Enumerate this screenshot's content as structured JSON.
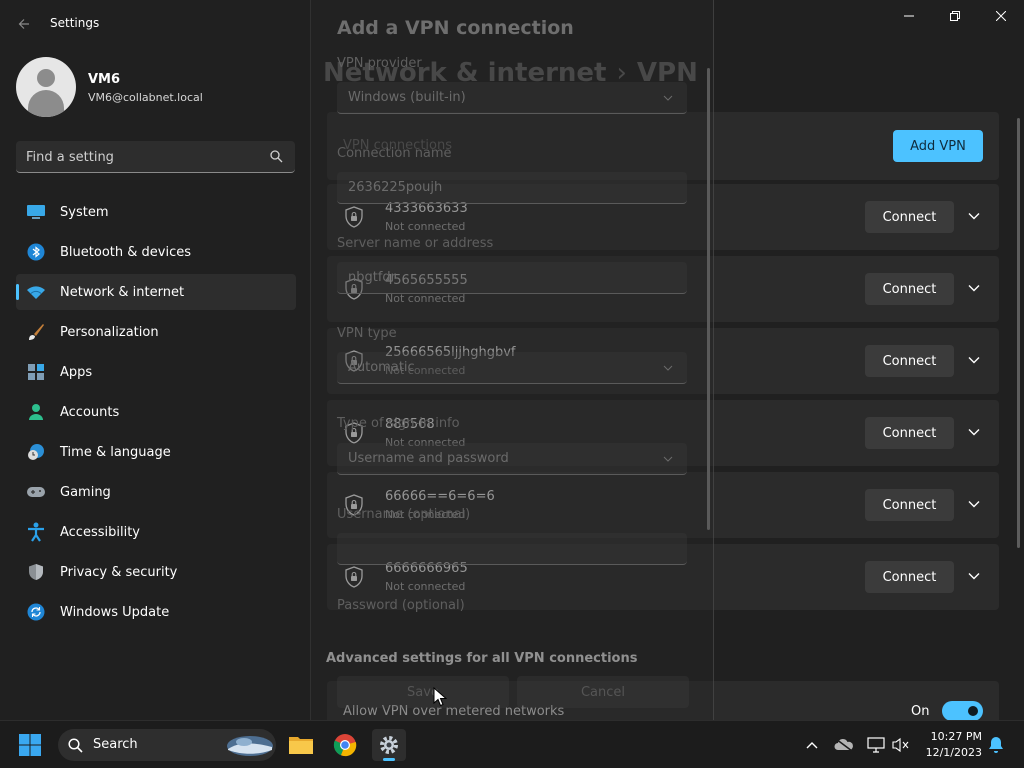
{
  "app": {
    "title": "Settings",
    "back_icon": "back-arrow-icon",
    "window_controls": [
      "minimize-icon",
      "maximize-icon",
      "close-icon"
    ]
  },
  "user": {
    "name": "VM6",
    "email": "VM6@collabnet.local"
  },
  "search": {
    "placeholder": "Find a setting"
  },
  "nav": {
    "items": [
      {
        "label": "System",
        "icon": "system-icon"
      },
      {
        "label": "Bluetooth & devices",
        "icon": "bluetooth-icon"
      },
      {
        "label": "Network & internet",
        "icon": "wifi-icon",
        "selected": true
      },
      {
        "label": "Personalization",
        "icon": "brush-icon"
      },
      {
        "label": "Apps",
        "icon": "apps-icon"
      },
      {
        "label": "Accounts",
        "icon": "accounts-icon"
      },
      {
        "label": "Time & language",
        "icon": "globe-clock-icon"
      },
      {
        "label": "Gaming",
        "icon": "gamepad-icon"
      },
      {
        "label": "Accessibility",
        "icon": "accessibility-icon"
      },
      {
        "label": "Privacy & security",
        "icon": "shield-icon"
      },
      {
        "label": "Windows Update",
        "icon": "update-icon"
      }
    ]
  },
  "page": {
    "breadcrumb_parent": "Network & internet",
    "breadcrumb_separator": "›",
    "breadcrumb_current": "VPN",
    "vpn_connections_label": "VPN connections",
    "add_vpn_label": "Add VPN",
    "connections": [
      {
        "name": "4333663633",
        "status": "Not connected",
        "action": "Connect"
      },
      {
        "name": "4565655555",
        "status": "Not connected",
        "action": "Connect"
      },
      {
        "name": "25666565ljjhghgbvf",
        "status": "Not connected",
        "action": "Connect"
      },
      {
        "name": "886568",
        "status": "Not connected",
        "action": "Connect"
      },
      {
        "name": "66666==6=6=6",
        "status": "Not connected",
        "action": "Connect"
      },
      {
        "name": "6666666965",
        "status": "Not connected",
        "action": "Connect"
      }
    ],
    "advanced_title": "Advanced settings for all VPN connections",
    "metered_label": "Allow VPN over metered networks",
    "metered_state": "On"
  },
  "dialog": {
    "title": "Add a VPN connection",
    "provider_label": "VPN provider",
    "provider_value": "Windows (built-in)",
    "connection_name_label": "Connection name",
    "connection_name_value": "2636225poujh",
    "server_label": "Server name or address",
    "server_value": "nbgtfdr",
    "vpn_type_label": "VPN type",
    "vpn_type_value": "Automatic",
    "signin_label": "Type of sign-in info",
    "signin_value": "Username and password",
    "username_label": "Username (optional)",
    "password_label": "Password (optional)",
    "save_label": "Save",
    "cancel_label": "Cancel"
  },
  "taskbar": {
    "search_label": "Search",
    "apps": [
      "windows-start-icon",
      "file-explorer-icon",
      "chrome-icon",
      "settings-gear-icon"
    ],
    "tray": [
      "chevron-up-icon",
      "onedrive-icon",
      "network-icon",
      "volume-muted-icon",
      "notification-bell-icon"
    ],
    "time": "10:27 PM",
    "date": "12/1/2023"
  },
  "colors": {
    "accent": "#4cc2ff",
    "background": "#202020",
    "card": "#2b2b2b"
  }
}
